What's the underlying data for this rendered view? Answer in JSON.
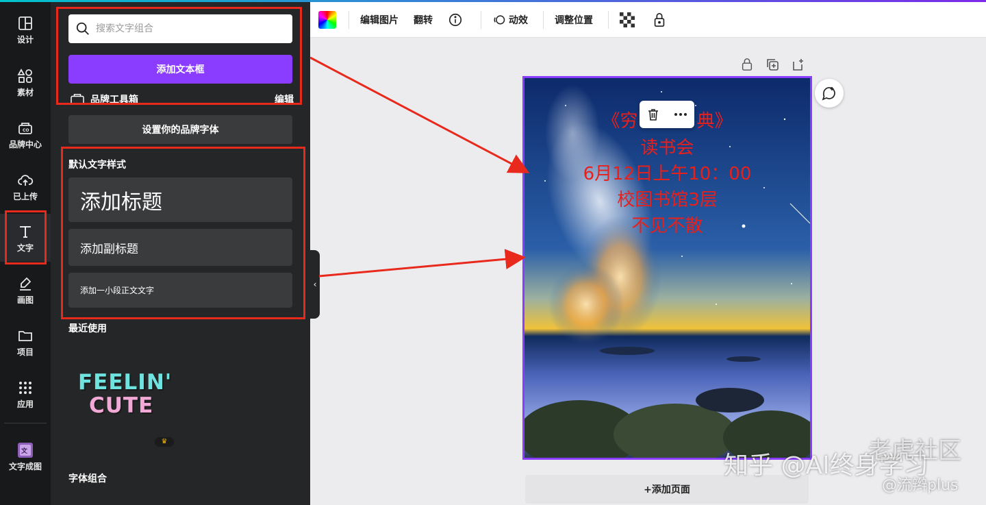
{
  "rail": {
    "items": [
      {
        "label": "设计",
        "icon": "layout-icon"
      },
      {
        "label": "素材",
        "icon": "shapes-icon"
      },
      {
        "label": "品牌中心",
        "icon": "brand-icon"
      },
      {
        "label": "已上传",
        "icon": "upload-cloud-icon"
      },
      {
        "label": "文字",
        "icon": "text-icon",
        "active": true
      },
      {
        "label": "画图",
        "icon": "draw-icon"
      },
      {
        "label": "项目",
        "icon": "folder-icon"
      },
      {
        "label": "应用",
        "icon": "apps-grid-icon"
      },
      {
        "label": "文字成图",
        "icon": "text-to-image-icon"
      }
    ]
  },
  "panel": {
    "search_placeholder": "搜索文字组合",
    "add_textbox": "添加文本框",
    "brand_kit": "品牌工具箱",
    "brand_edit": "编辑",
    "set_brand_font": "设置你的品牌字体",
    "default_styles_title": "默认文字样式",
    "add_heading": "添加标题",
    "add_subheading": "添加副标题",
    "add_body": "添加一小段正文文字",
    "recent_title": "最近使用",
    "recent_line1": "FEELIN'",
    "recent_line2": "CUTE",
    "font_combos_title": "字体组合"
  },
  "toolbar": {
    "edit_image": "编辑图片",
    "flip": "翻转",
    "animate": "动效",
    "position": "调整位置"
  },
  "poster": {
    "line1": "《穷",
    "line1b": "典》",
    "line2": "读书会",
    "line3": "6月12日上午10：00",
    "line4": "校图书馆3层",
    "line5": "不见不散"
  },
  "add_page": "+添加页面",
  "watermark": {
    "zhihu": "知乎 @AI终身学习",
    "site": "老虎社区",
    "handle": "@流辫plus"
  },
  "colors": {
    "accent": "#8b3dff",
    "annotation_red": "#e8291c",
    "poster_text": "#e8201c"
  }
}
